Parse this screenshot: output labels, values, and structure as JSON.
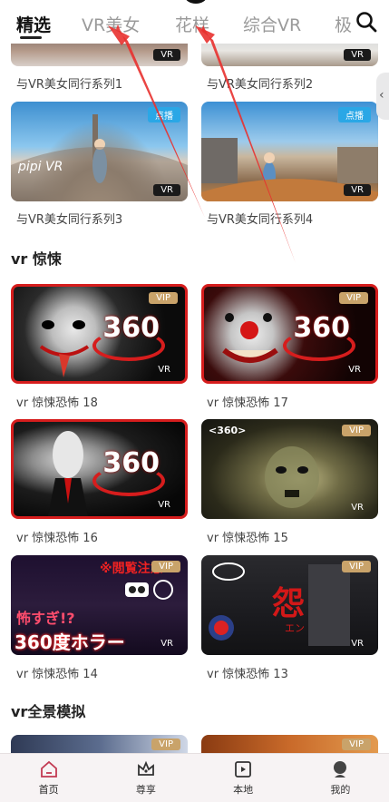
{
  "tabs": {
    "items": [
      {
        "label": "精选"
      },
      {
        "label": "VR美女"
      },
      {
        "label": "花样"
      },
      {
        "label": "综合VR"
      },
      {
        "label": "极"
      }
    ],
    "active_index": 0
  },
  "badges": {
    "vr": "VR",
    "vip": "VIP",
    "play": "点播"
  },
  "section1": {
    "items": [
      {
        "caption": "与VR美女同行系列1"
      },
      {
        "caption": "与VR美女同行系列2"
      },
      {
        "caption": "与VR美女同行系列3",
        "watermark": "pipi VR"
      },
      {
        "caption": "与VR美女同行系列4"
      }
    ]
  },
  "section2": {
    "title": "vr 惊悚",
    "items": [
      {
        "caption": "vr 惊悚恐怖 18",
        "overlay": "360"
      },
      {
        "caption": "vr 惊悚恐怖 17",
        "overlay": "360"
      },
      {
        "caption": "vr 惊悚恐怖 16",
        "overlay": "360"
      },
      {
        "caption": "vr 惊悚恐怖 15",
        "overlay": "<360>"
      },
      {
        "caption": "vr 惊悚恐怖 14",
        "overlay_top": "※閲覧注意",
        "overlay_mid": "怖すぎ!?",
        "overlay_bottom": "360度ホラー"
      },
      {
        "caption": "vr 惊悚恐怖 13",
        "overlay": "怨",
        "overlay_small": "エン"
      }
    ]
  },
  "section3": {
    "title": "vr全景模拟"
  },
  "bottom_nav": {
    "items": [
      {
        "label": "首页",
        "icon": "home-icon"
      },
      {
        "label": "尊享",
        "icon": "crown-icon"
      },
      {
        "label": "本地",
        "icon": "local-video-icon"
      },
      {
        "label": "我的",
        "icon": "profile-icon"
      }
    ]
  },
  "colors": {
    "accent_red": "#d61d1d",
    "vip_gold": "#c9a36a",
    "play_blue": "#2aa7e6"
  }
}
